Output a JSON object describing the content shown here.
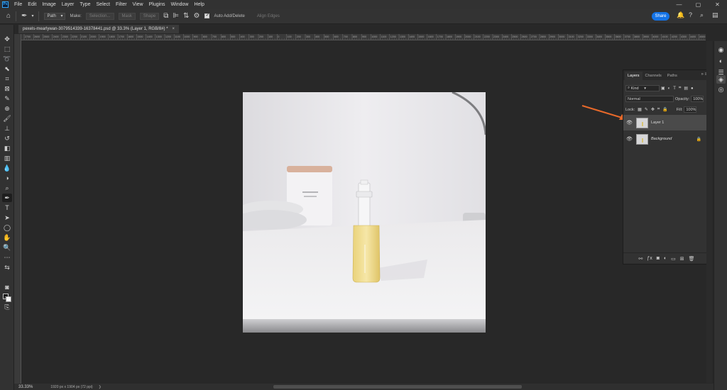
{
  "app": {
    "logo": "Ps"
  },
  "menu": [
    "File",
    "Edit",
    "Image",
    "Layer",
    "Type",
    "Select",
    "Filter",
    "View",
    "Plugins",
    "Window",
    "Help"
  ],
  "window_controls": [
    "—",
    "▢",
    "✕"
  ],
  "options": {
    "mode": "Path",
    "make_label": "Make:",
    "selection_btn": "Selection...",
    "mask_btn": "Mask",
    "shape_btn": "Shape",
    "auto_add_delete": "Auto Add/Delete",
    "align_edges": "Align Edges",
    "share": "Share"
  },
  "document": {
    "tab_title": "pexels-mearlywan-3079514339-16378441.psd @ 33.3% (Layer 1, RGB/8#) *",
    "close": "×"
  },
  "ruler": {
    "labels": [
      "2700",
      "2600",
      "2500",
      "2400",
      "2300",
      "2200",
      "2100",
      "2000",
      "1900",
      "1800",
      "1700",
      "1600",
      "1500",
      "1400",
      "1300",
      "1200",
      "1100",
      "1000",
      "900",
      "800",
      "700",
      "600",
      "500",
      "400",
      "300",
      "200",
      "100",
      "0",
      "100",
      "200",
      "300",
      "400",
      "500",
      "600",
      "700",
      "800",
      "900",
      "1000",
      "1100",
      "1200",
      "1300",
      "1400",
      "1500",
      "1600",
      "1700",
      "1800",
      "1900",
      "2000",
      "2100",
      "2200",
      "2300",
      "2400",
      "2500",
      "2600",
      "2700",
      "2800",
      "2900",
      "3000",
      "3100",
      "3200",
      "3300",
      "3400",
      "3500",
      "3600",
      "3700",
      "3800",
      "3900",
      "4000",
      "4100",
      "4200",
      "4300",
      "4400",
      "4500"
    ]
  },
  "layers_panel": {
    "tabs": [
      "Layers",
      "Channels",
      "Paths"
    ],
    "active_tab": "Layers",
    "panel_controls": "»  ≡",
    "filter_kind": "Kind",
    "blend_mode": "Normal",
    "opacity_label": "Opacity:",
    "opacity_value": "100%",
    "lock_label": "Lock:",
    "fill_label": "Fill:",
    "fill_value": "100%",
    "layers": [
      {
        "name": "Layer 1",
        "selected": true,
        "locked": false
      },
      {
        "name": "Background",
        "selected": false,
        "locked": true
      }
    ]
  },
  "status": {
    "zoom": "33.33%",
    "doc_size": "1920 px x 1904 px (72 ppi)"
  },
  "colors": {
    "accent": "#1473e6",
    "annotation_arrow": "#e8692a",
    "canvas_bg": "#282828"
  },
  "icons": [
    "move-icon",
    "marquee-icon",
    "lasso-icon",
    "object-select-icon",
    "crop-icon",
    "frame-icon",
    "eyedropper-icon",
    "healing-icon",
    "brush-icon",
    "stamp-icon",
    "history-brush-icon",
    "eraser-icon",
    "gradient-icon",
    "blur-icon",
    "dodge-icon",
    "pen-icon",
    "type-icon",
    "path-select-icon",
    "shape-icon",
    "hand-icon",
    "zoom-icon"
  ]
}
